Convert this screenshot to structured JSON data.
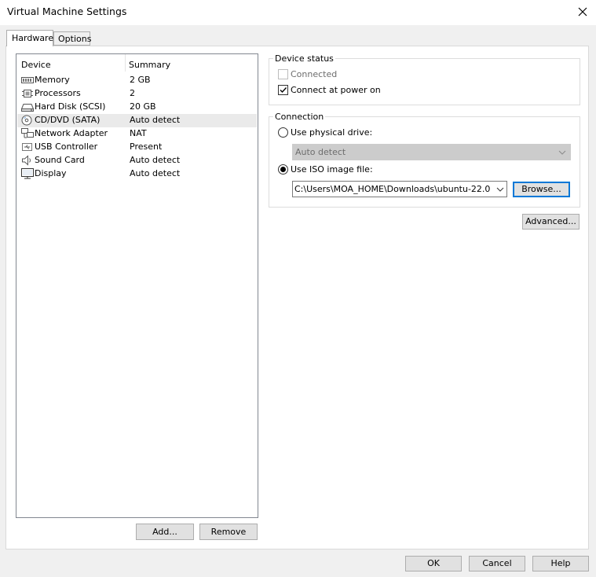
{
  "window": {
    "title": "Virtual Machine Settings",
    "close_icon": "close-icon"
  },
  "tabs": [
    {
      "label": "Hardware",
      "active": true
    },
    {
      "label": "Options",
      "active": false
    }
  ],
  "device_table": {
    "headers": {
      "device": "Device",
      "summary": "Summary"
    },
    "rows": [
      {
        "name": "Memory",
        "summary": "2 GB",
        "icon": "memory-icon"
      },
      {
        "name": "Processors",
        "summary": "2",
        "icon": "processor-icon"
      },
      {
        "name": "Hard Disk (SCSI)",
        "summary": "20 GB",
        "icon": "hard-disk-icon"
      },
      {
        "name": "CD/DVD (SATA)",
        "summary": "Auto detect",
        "icon": "cd-dvd-icon",
        "selected": true
      },
      {
        "name": "Network Adapter",
        "summary": "NAT",
        "icon": "network-adapter-icon"
      },
      {
        "name": "USB Controller",
        "summary": "Present",
        "icon": "usb-icon"
      },
      {
        "name": "Sound Card",
        "summary": "Auto detect",
        "icon": "speaker-icon"
      },
      {
        "name": "Display",
        "summary": "Auto detect",
        "icon": "monitor-icon"
      }
    ]
  },
  "list_buttons": {
    "add": "Add...",
    "remove": "Remove"
  },
  "device_status": {
    "label": "Device status",
    "connected": {
      "label": "Connected",
      "checked": false,
      "enabled": false
    },
    "connect_at_power_on": {
      "label": "Connect at power on",
      "checked": true
    }
  },
  "connection": {
    "label": "Connection",
    "physical_drive": {
      "label": "Use physical drive:",
      "selected": false,
      "value": "Auto detect"
    },
    "iso_image": {
      "label": "Use ISO image file:",
      "selected": true,
      "value": "C:\\Users\\MOA_HOME\\Downloads\\ubuntu-22.0"
    },
    "browse": "Browse..."
  },
  "advanced": "Advanced...",
  "footer": {
    "ok": "OK",
    "cancel": "Cancel",
    "help": "Help"
  }
}
